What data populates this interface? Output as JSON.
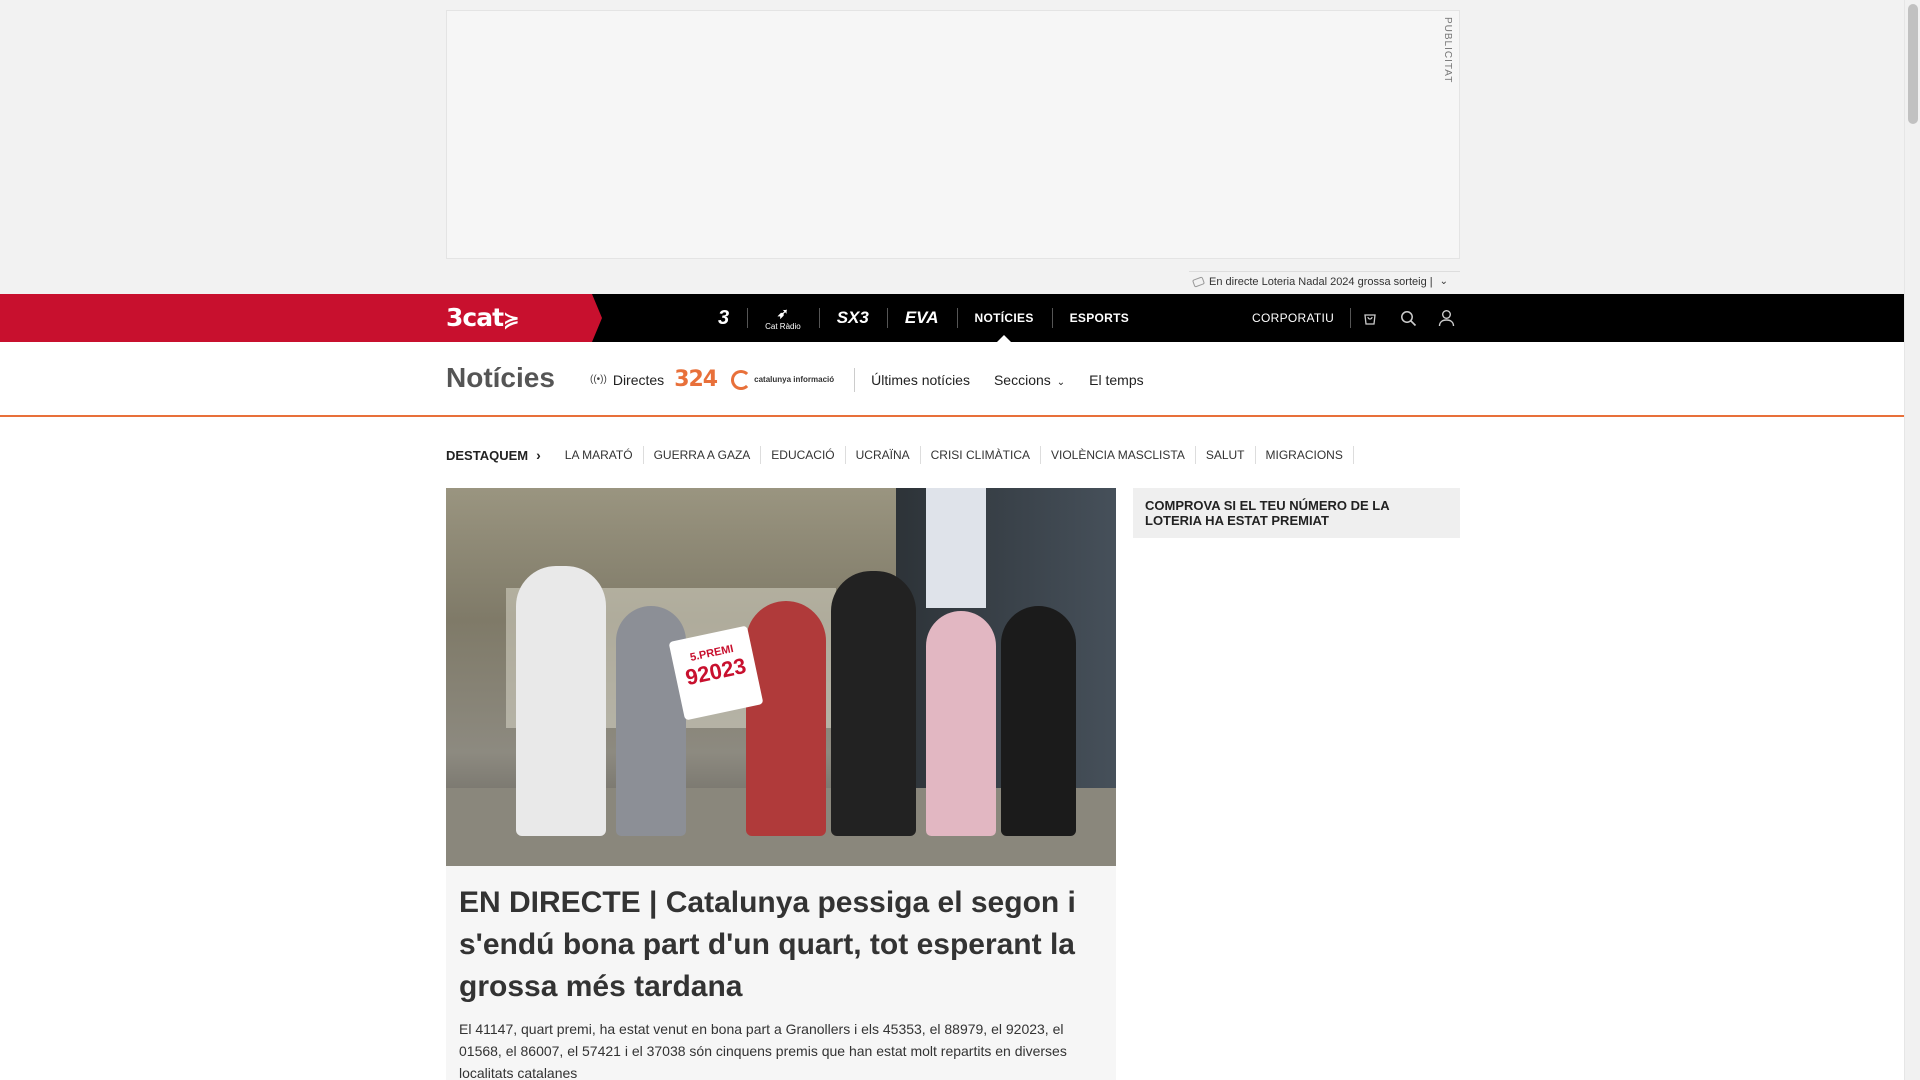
{
  "ad": {
    "label": "PUBLICITAT"
  },
  "ticker": {
    "text": "En directe Loteria Nadal 2024 grossa sorteig |"
  },
  "topbar": {
    "brand": "3cat",
    "channels": [
      {
        "label": "3",
        "type": "tv3-logo"
      },
      {
        "label": "Cat Ràdio",
        "type": "catradio-logo"
      },
      {
        "label": "SX3",
        "type": "sx3-logo"
      },
      {
        "label": "EVA",
        "type": "eva-logo"
      },
      {
        "label": "NOTÍCIES",
        "type": "text",
        "active": true
      },
      {
        "label": "ESPORTS",
        "type": "text"
      }
    ],
    "corporatiu": "CORPORATIU"
  },
  "section": {
    "title": "Notícies",
    "directes": "Directes",
    "logo_324": "324",
    "logo_ci": "catalunya informació",
    "links": {
      "ultimes": "Últimes notícies",
      "seccions": "Seccions",
      "temps": "El temps"
    }
  },
  "highlights": {
    "title": "DESTAQUEM",
    "items": [
      "LA MARATÓ",
      "GUERRA A GAZA",
      "EDUCACIÓ",
      "UCRAÏNA",
      "CRISI CLIMÀTICA",
      "VIOLÈNCIA MASCLISTA",
      "SALUT",
      "MIGRACIONS"
    ]
  },
  "article": {
    "image_sign_top": "5.PREMI",
    "image_sign_number": "92023",
    "title": "EN DIRECTE | Catalunya pessiga el segon i s'endú bona part d'un quart, tot esperant la grossa més tardana",
    "lead": "El 41147, quart premi, ha estat venut en bona part a Granollers i els 45353, el 88979, el 92023, el 01568, el 86007, el 57421 i el 37038 són cinquens premis que han estat molt repartits en diverses localitats catalanes"
  },
  "sidebar": {
    "button": "COMPROVA SI EL TEU NÚMERO DE LA LOTERIA HA ESTAT PREMIAT"
  },
  "colors": {
    "brand_red": "#c8102e",
    "accent_orange": "#e8703a",
    "topbar_bg": "#000000"
  }
}
